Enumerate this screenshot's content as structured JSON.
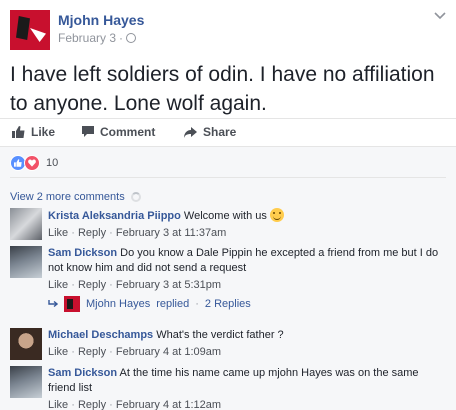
{
  "post": {
    "author": "Mjohn Hayes",
    "date": "February 3",
    "separator": "·",
    "text": "I have left soldiers of odin. I have no affiliation to anyone. Lone wolf again."
  },
  "actions": {
    "like": "Like",
    "comment": "Comment",
    "share": "Share"
  },
  "reactions": {
    "count": "10",
    "types": [
      "like",
      "love"
    ]
  },
  "view_more": "View 2 more comments",
  "comments": [
    {
      "name": "Krista Aleksandria Piippo",
      "text": "Welcome with us",
      "like": "Like",
      "reply": "Reply",
      "time": "February 3 at 11:37am"
    },
    {
      "name": "Sam Dickson",
      "text": "Do you know a Dale Pippin he excepted a friend from me but I do not know him and did not send a request",
      "like": "Like",
      "reply": "Reply",
      "time": "February 3 at 5:31pm"
    },
    {
      "name": "Michael Deschamps",
      "text": "What's the verdict father ?",
      "like": "Like",
      "reply": "Reply",
      "time": "February 4 at 1:09am"
    },
    {
      "name": "Sam Dickson",
      "text": "At the time his name came up mjohn Hayes was on the same friend list",
      "like": "Like",
      "reply": "Reply",
      "time": "February 4 at 1:12am"
    }
  ],
  "replied": {
    "name": "Mjohn Hayes",
    "action": "replied",
    "count": "2 Replies"
  },
  "colors": {
    "link": "#365899",
    "muted": "#90949c",
    "like_blue": "#5890ff",
    "love_red": "#f25268"
  }
}
